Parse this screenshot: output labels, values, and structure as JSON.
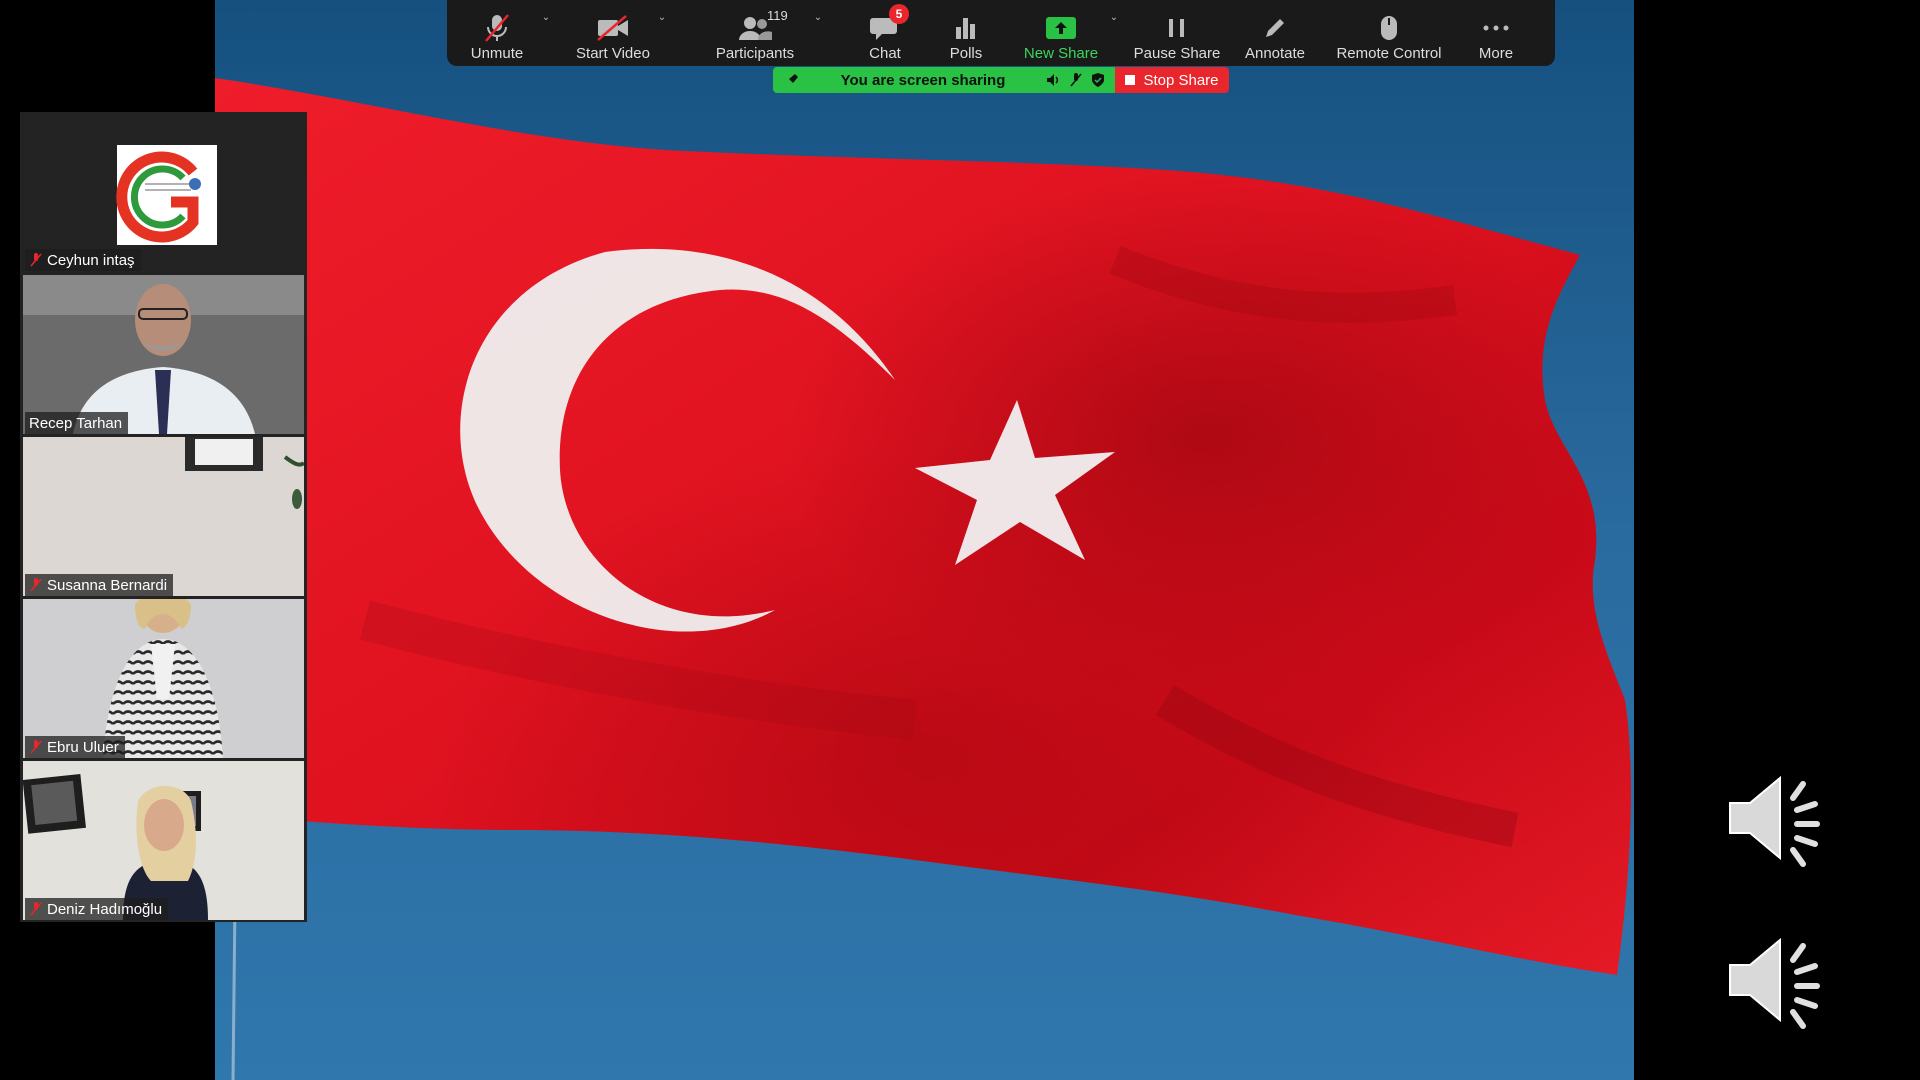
{
  "toolbar": {
    "unmute": "Unmute",
    "start_video": "Start Video",
    "participants": "Participants",
    "participants_count": "119",
    "chat": "Chat",
    "chat_badge": "5",
    "polls": "Polls",
    "new_share": "New Share",
    "pause_share": "Pause Share",
    "annotate": "Annotate",
    "remote_control": "Remote Control",
    "more": "More"
  },
  "share_bar": {
    "message": "You are screen sharing",
    "stop_label": "Stop Share"
  },
  "gallery": {
    "participants": [
      {
        "name": "Ceyhun intaş",
        "muted": true,
        "video": "logo"
      },
      {
        "name": "Recep Tarhan",
        "muted": false,
        "video": "camera",
        "active_speaker": true
      },
      {
        "name": "Susanna Bernardi",
        "muted": true,
        "video": "camera"
      },
      {
        "name": "Ebru Uluer",
        "muted": true,
        "video": "camera"
      },
      {
        "name": "Deniz Hadımoğlu",
        "muted": true,
        "video": "camera"
      }
    ]
  },
  "shared_content": {
    "subject": "turkish-flag",
    "colors": {
      "flag_red": "#e4121e",
      "sky_blue": "#1e5f93",
      "crescent_white": "#f2f2f2"
    }
  },
  "colors": {
    "toolbar_bg": "#1a1a1a",
    "share_green": "#29c244",
    "stop_red": "#e8262b",
    "new_share_green": "#3cd45e",
    "badge_red": "#e8262b"
  }
}
